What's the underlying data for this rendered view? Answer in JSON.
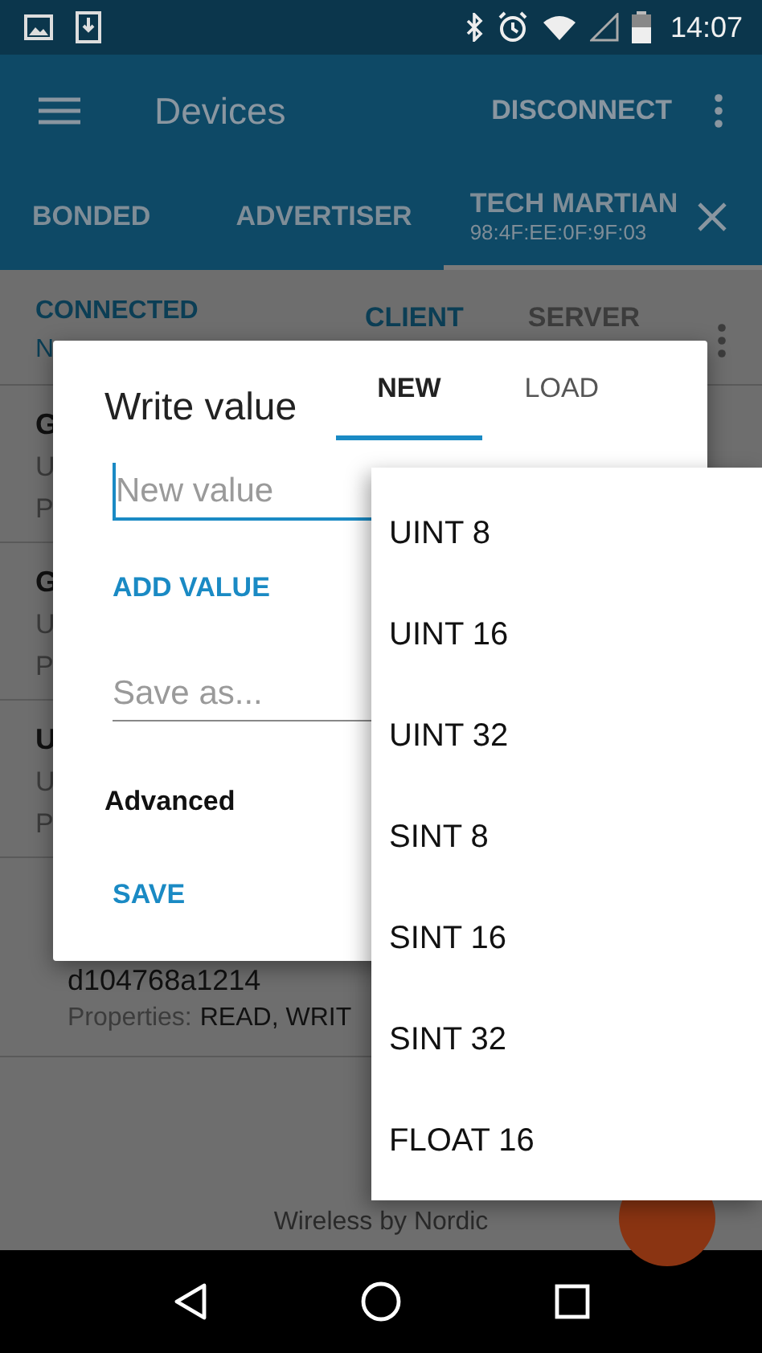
{
  "status_bar": {
    "time": "14:07"
  },
  "app_bar": {
    "title": "Devices",
    "action": "DISCONNECT"
  },
  "tabs": [
    {
      "label": "BONDED",
      "selected": false
    },
    {
      "label": "ADVERTISER",
      "selected": false
    },
    {
      "label": "TECH MARTIAN",
      "subtitle": "98:4F:EE:0F:9F:03",
      "selected": true
    }
  ],
  "connection": {
    "status": "CONNECTED",
    "state": "N",
    "tabs": [
      {
        "label": "CLIENT",
        "selected": true
      },
      {
        "label": "SERVER",
        "selected": false
      }
    ]
  },
  "services": [
    {
      "title": "G",
      "uuid": "U",
      "properties": "P"
    },
    {
      "title": "G",
      "uuid": "U",
      "properties": "P"
    },
    {
      "title": "U",
      "uuid": "U",
      "properties": "P"
    }
  ],
  "characteristic": {
    "uuid": "d104768a1214",
    "properties_label": "Properties:",
    "properties": "READ, WRIT"
  },
  "footer": "Wireless by Nordic",
  "dialog": {
    "title": "Write value",
    "tabs": [
      {
        "label": "NEW",
        "selected": true
      },
      {
        "label": "LOAD",
        "selected": false
      }
    ],
    "value_field": {
      "placeholder": "New value",
      "focused": true
    },
    "add_button": "ADD VALUE",
    "save_field": {
      "placeholder": "Save as...",
      "focused": false
    },
    "advanced": "Advanced",
    "save_button": "SAVE"
  },
  "dropdown": {
    "items": [
      "UINT 8",
      "UINT 16",
      "UINT 32",
      "SINT 8",
      "SINT 16",
      "SINT 32",
      "FLOAT 16"
    ]
  }
}
